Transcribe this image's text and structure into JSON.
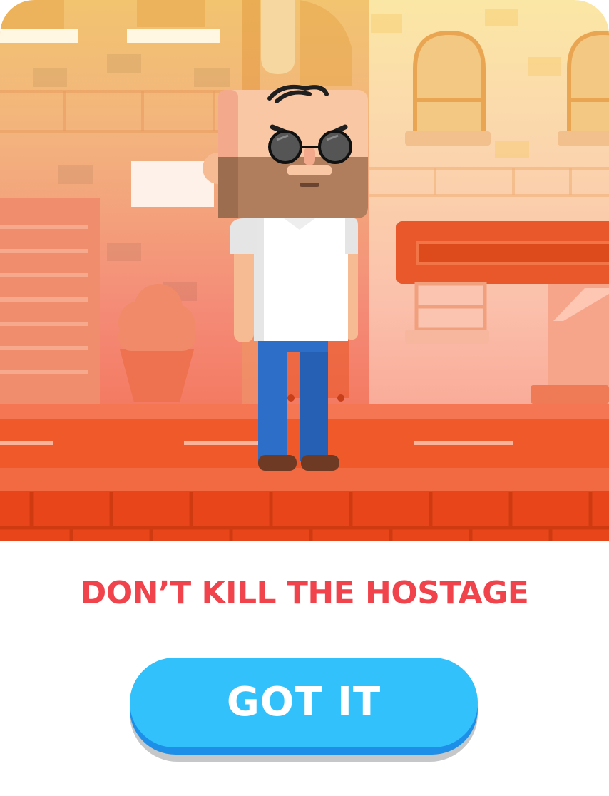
{
  "dialog": {
    "message": "DON’T KILL THE HOSTAGE",
    "button_label": "GOT IT"
  },
  "scene": {
    "subject": "hostage",
    "icons": [
      "hostage-character-icon",
      "sunglasses-icon",
      "ice-cream-sign-icon",
      "shop-awning-icon",
      "arched-window-icon"
    ]
  },
  "colors": {
    "message": "#f0434c",
    "button_face": "#33c1fb",
    "button_edge": "#1e8fe8",
    "button_text": "#ffffff",
    "road": "#f05a2b",
    "curb": "#e8461a",
    "sky_top": "#f7c66b"
  }
}
